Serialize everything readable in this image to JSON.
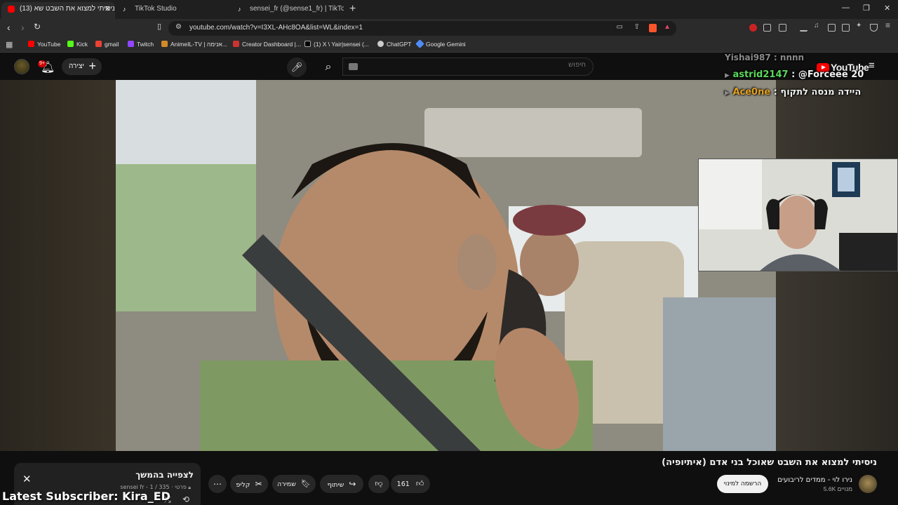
{
  "browser": {
    "tabs": [
      {
        "label": "(13) ניסיתי למצוא את השבט שא...",
        "favicon_color": "#ff0000",
        "active": true
      },
      {
        "label": "TikTok Studio",
        "favicon_color": "#ffffff",
        "active": false
      },
      {
        "label": "sensei_fr (@sense1_fr) | TikTok",
        "favicon_color": "#ffffff",
        "active": false
      }
    ],
    "url": "youtube.com/watch?v=I3XL-AHc8OA&list=WL&index=1",
    "bookmarks": [
      {
        "label": "YouTube",
        "color": "#ff0000"
      },
      {
        "label": "Kick",
        "color": "#53fc18"
      },
      {
        "label": "gmail",
        "color": "#ea4335"
      },
      {
        "label": "Twitch",
        "color": "#9146ff"
      },
      {
        "label": "AnimeIL-TV | אנימה...",
        "color": "#d08a2a"
      },
      {
        "label": "Creator Dashboard |...",
        "color": "#cc3333"
      },
      {
        "label": "(1) X \\ Yair|sensei (...",
        "color": "#ffffff"
      },
      {
        "label": "ChatGPT",
        "color": "#cccccc"
      },
      {
        "label": "Google Gemini",
        "color": "#4f8cf7"
      }
    ]
  },
  "youtube": {
    "notification_count": "9+",
    "create_label": "יצירה",
    "search_placeholder": "חיפוש",
    "logo_text": "YouTube"
  },
  "chat": [
    {
      "user": "Yishai987",
      "message": "nnnn",
      "user_color": "#9a9a9a"
    },
    {
      "user": "astrid2147",
      "message": "@Forceee 20",
      "user_color": "#5cd65c"
    },
    {
      "user": "Ace0ne",
      "message": "היידה מנסה לתקוף",
      "user_color": "#e0a020"
    }
  ],
  "video": {
    "title": "ניסיתי למצוא את השבט שאוכל בני אדם (איתיופיה)",
    "channel_name": "נירו לוי - ממדים לריבועים",
    "subscribers": "5.6K מנויים",
    "subscribe_label": "הרשמה למינוי",
    "likes": "161",
    "share_label": "שיתוף",
    "save_label": "שמירה",
    "clip_label": "קליפ"
  },
  "playlist": {
    "title": "לצפייה בהמשך",
    "meta": "פרטי · sensei fr - 1 / 335"
  },
  "overlay": {
    "latest_subscriber": "Latest Subscriber: Kira_ED"
  }
}
